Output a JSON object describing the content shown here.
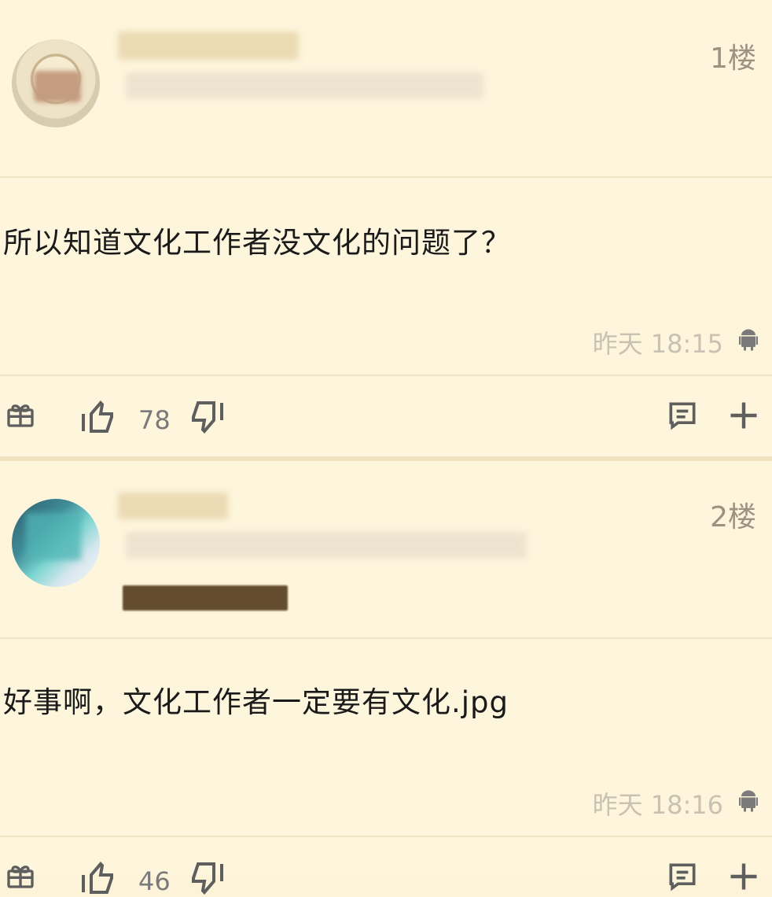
{
  "posts": [
    {
      "floor": "1楼",
      "content": "所以知道文化工作者没文化的问题了？",
      "time": "昨天 18:15",
      "likes": "78"
    },
    {
      "floor": "2楼",
      "content": "好事啊，文化工作者一定要有文化.jpg",
      "time": "昨天 18:16",
      "likes": "46"
    }
  ],
  "colors": {
    "background": "#fdf5dc",
    "icon": "#5e5e5e",
    "muted_text": "#c9c2b2",
    "floor_text": "#9b9281"
  },
  "icons": [
    "gift-icon",
    "thumbs-up-icon",
    "thumbs-down-icon",
    "comment-icon",
    "plus-icon",
    "android-icon"
  ]
}
